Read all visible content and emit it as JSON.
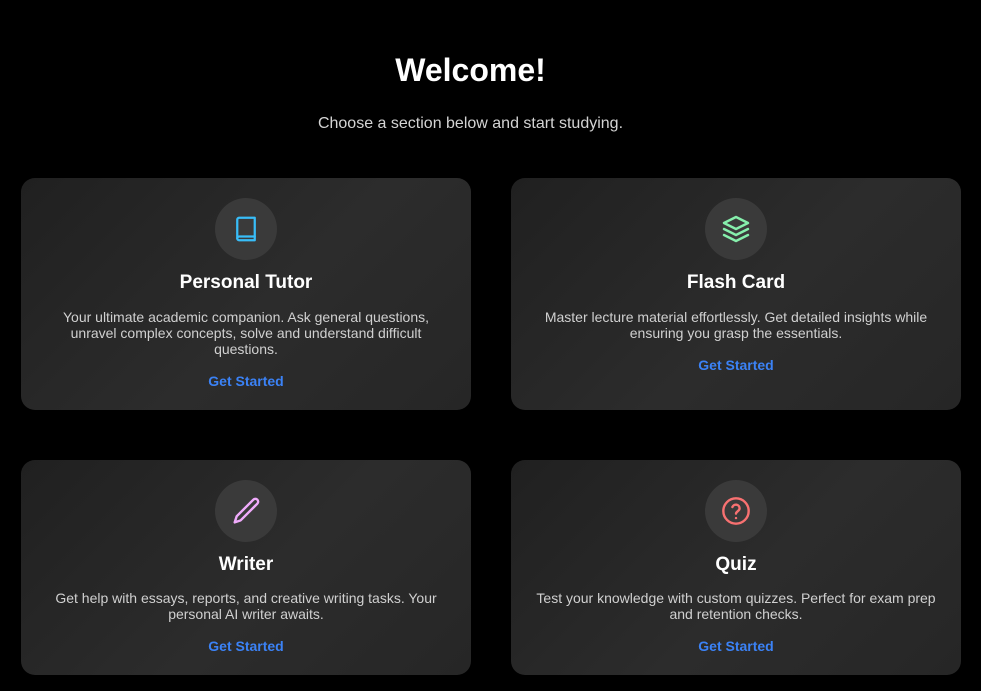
{
  "header": {
    "title": "Welcome!",
    "subtitle": "Choose a section below and start studying."
  },
  "cards": [
    {
      "title": "Personal Tutor",
      "description": "Your ultimate academic companion. Ask general questions, unravel complex concepts, solve and understand difficult questions.",
      "cta": "Get Started",
      "icon": "book-icon",
      "icon_color": "#38bdf8"
    },
    {
      "title": "Flash Card",
      "description": "Master lecture material effortlessly. Get detailed insights while ensuring you grasp the essentials.",
      "cta": "Get Started",
      "icon": "layers-icon",
      "icon_color": "#86efac"
    },
    {
      "title": "Writer",
      "description": "Get help with essays, reports, and creative writing tasks. Your personal AI writer awaits.",
      "cta": "Get Started",
      "icon": "pencil-icon",
      "icon_color": "#f0abfc"
    },
    {
      "title": "Quiz",
      "description": "Test your knowledge with custom quizzes. Perfect for exam prep and retention checks.",
      "cta": "Get Started",
      "icon": "help-circle-icon",
      "icon_color": "#f87171"
    }
  ],
  "colors": {
    "background": "#000000",
    "card": "#262626",
    "icon_circle": "#3a3a3a",
    "link": "#3b82f6"
  }
}
